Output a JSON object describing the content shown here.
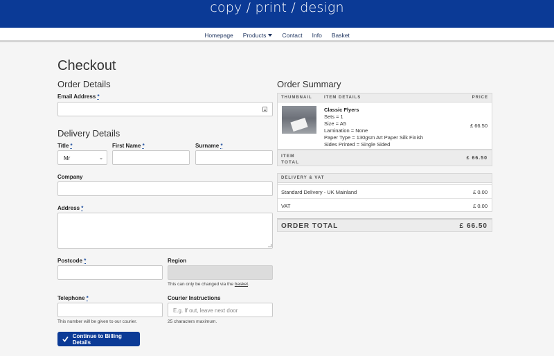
{
  "header": {
    "brand": "copy / print / design",
    "nav": [
      "Homepage",
      "Products",
      "Contact",
      "Info",
      "Basket"
    ]
  },
  "page": {
    "title": "Checkout"
  },
  "order_details": {
    "heading": "Order Details",
    "email_label": "Email Address",
    "required_mark": "*"
  },
  "delivery": {
    "heading": "Delivery Details",
    "title_label": "Title",
    "title_value": "Mr",
    "first_name_label": "First Name",
    "surname_label": "Surname",
    "company_label": "Company",
    "address_label": "Address",
    "postcode_label": "Postcode",
    "region_label": "Region",
    "region_help_prefix": "This can only be changed via the ",
    "region_help_link": "basket",
    "region_help_suffix": ".",
    "telephone_label": "Telephone",
    "telephone_help": "This number will be given to our courier.",
    "courier_label": "Courier Instructions",
    "courier_placeholder": "E.g. If out, leave next door",
    "courier_help": "25 characters maximum.",
    "submit": "Continue to Billing Details"
  },
  "summary": {
    "heading": "Order Summary",
    "columns": [
      "THUMBNAIL",
      "ITEM DETAILS",
      "PRICE"
    ],
    "item": {
      "name": "Classic Flyers",
      "details": [
        "Sets = 1",
        "Size = A5",
        "Lamination = None",
        "Paper Type = 130gsm Art Paper Silk Finish",
        "Sides Printed = Single Sided"
      ],
      "price": "£ 66.50"
    },
    "item_total_label": "ITEM TOTAL",
    "item_total_value": "£ 66.50",
    "delivery_heading": "DELIVERY & VAT",
    "delivery_rows": [
      {
        "label": "Standard Delivery - UK Mainland",
        "value": "£ 0.00"
      },
      {
        "label": "VAT",
        "value": "£ 0.00"
      }
    ],
    "order_total_label": "ORDER TOTAL",
    "order_total_value": "£ 66.50"
  }
}
